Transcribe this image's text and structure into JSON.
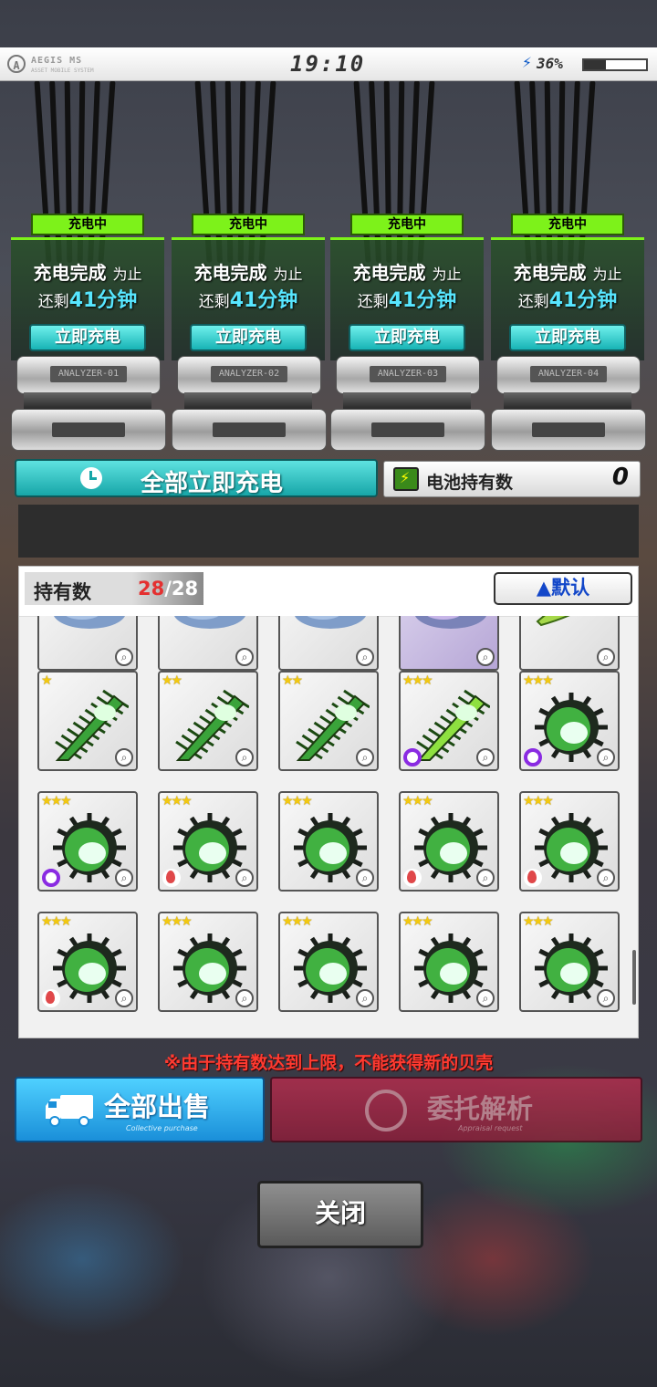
{
  "status_bar": {
    "app_name": "AEGIS MS",
    "app_sub": "ASSET MOBILE SYSTEM",
    "time": "19:10",
    "battery_percent": "36%",
    "battery_level": 0.36
  },
  "slots": [
    {
      "status": "充电中",
      "line1_main": "充电完成",
      "line1_suffix": "为止",
      "line2_prefix": "还剩",
      "remaining": "41分钟",
      "button": "立即充电",
      "device_label": "ANALYZER-01"
    },
    {
      "status": "充电中",
      "line1_main": "充电完成",
      "line1_suffix": "为止",
      "line2_prefix": "还剩",
      "remaining": "41分钟",
      "button": "立即充电",
      "device_label": "ANALYZER-02"
    },
    {
      "status": "充电中",
      "line1_main": "充电完成",
      "line1_suffix": "为止",
      "line2_prefix": "还剩",
      "remaining": "41分钟",
      "button": "立即充电",
      "device_label": "ANALYZER-03"
    },
    {
      "status": "充电中",
      "line1_main": "充电完成",
      "line1_suffix": "为止",
      "line2_prefix": "还剩",
      "remaining": "41分钟",
      "button": "立即充电",
      "device_label": "ANALYZER-04"
    }
  ],
  "charge_all": {
    "label": "全部立即充电",
    "icon": "clock-icon"
  },
  "battery_hold": {
    "label": "电池持有数",
    "count": "0",
    "icon": "battery-icon"
  },
  "inventory": {
    "hold_label": "持有数",
    "hold_current": "28",
    "hold_max": "/28",
    "sort_label": "▲默认",
    "items": [
      {
        "stars": "",
        "attr": "none",
        "shell": "blue"
      },
      {
        "stars": "",
        "attr": "none",
        "shell": "blue"
      },
      {
        "stars": "",
        "attr": "none",
        "shell": "blue"
      },
      {
        "stars": "",
        "attr": "none",
        "shell": "purple"
      },
      {
        "stars": "",
        "attr": "none",
        "shell": "leaf"
      },
      {
        "stars": "★",
        "attr": "none",
        "shell": "spiky"
      },
      {
        "stars": "★★",
        "attr": "none",
        "shell": "spiky"
      },
      {
        "stars": "★★",
        "attr": "none",
        "shell": "spiky"
      },
      {
        "stars": "★★★",
        "attr": "purple",
        "shell": "spiky-light"
      },
      {
        "stars": "★★★",
        "attr": "purple",
        "shell": "murex"
      },
      {
        "stars": "★★★",
        "attr": "purple",
        "shell": "murex"
      },
      {
        "stars": "★★★",
        "attr": "fire",
        "shell": "murex"
      },
      {
        "stars": "★★★",
        "attr": "none",
        "shell": "murex"
      },
      {
        "stars": "★★★",
        "attr": "fire",
        "shell": "murex"
      },
      {
        "stars": "★★★",
        "attr": "fire",
        "shell": "murex"
      },
      {
        "stars": "★★★",
        "attr": "fire",
        "shell": "murex"
      },
      {
        "stars": "★★★",
        "attr": "none",
        "shell": "murex"
      },
      {
        "stars": "★★★",
        "attr": "none",
        "shell": "murex"
      },
      {
        "stars": "★★★",
        "attr": "none",
        "shell": "murex"
      },
      {
        "stars": "★★★",
        "attr": "none",
        "shell": "murex"
      }
    ]
  },
  "notice": "※由于持有数达到上限，不能获得新的贝壳",
  "sell_all": {
    "label": "全部出售",
    "sub": "Collective purchase",
    "icon": "truck-icon"
  },
  "analyze": {
    "label": "委托解析",
    "sub": "Appraisal request",
    "icon": "analyze-icon"
  },
  "close": {
    "label": "关闭"
  },
  "colors": {
    "accent_green": "#7df21a",
    "teal": "#17b3b5",
    "time_cyan": "#57e6ff",
    "notice_red": "#ff3a30",
    "sell_blue": "#1a8fd9",
    "analyze_red": "#8a1f3a"
  }
}
